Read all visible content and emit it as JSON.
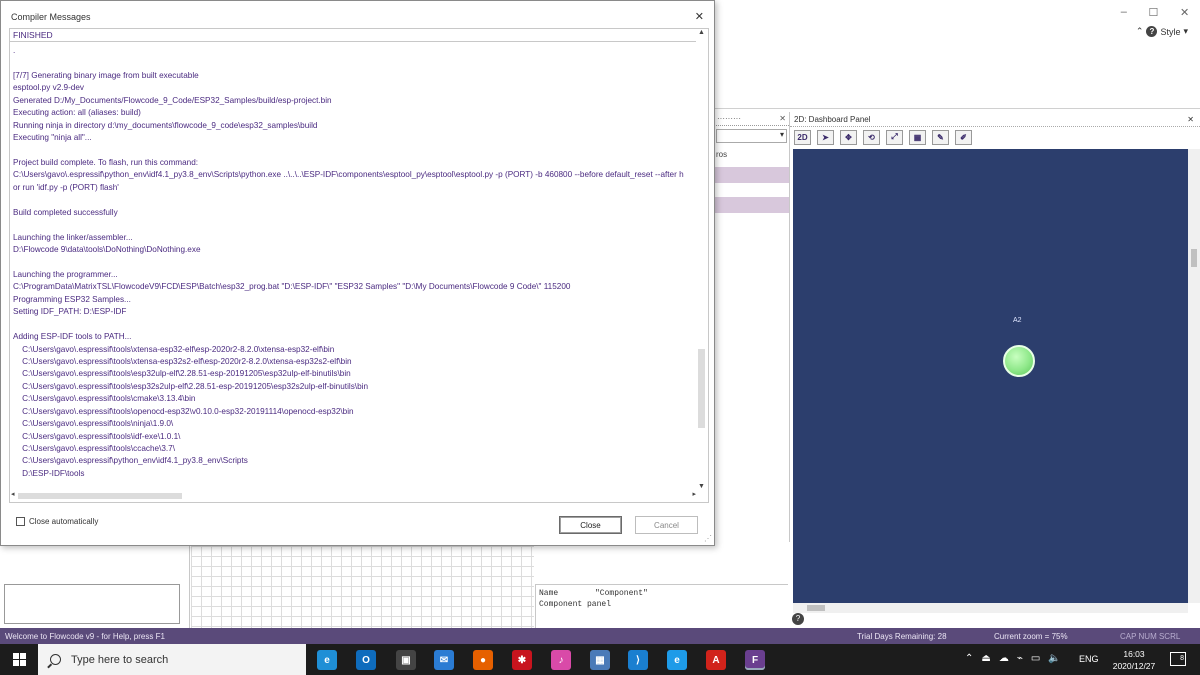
{
  "app": {
    "style_label": "Style",
    "help_label": "?",
    "window_controls": [
      "–",
      "☐",
      "✕"
    ]
  },
  "side_panel": {
    "tab_fragment": "ros"
  },
  "dashboard": {
    "title": "2D: Dashboard Panel",
    "toolbar_label": "2D",
    "component_label": "A2",
    "background_color": "#2c3e6d",
    "component_color": "#8fe88a"
  },
  "properties": {
    "rows": [
      {
        "key": "Name",
        "value": "\"Component\""
      },
      {
        "key": "Component panel",
        "value": ""
      }
    ]
  },
  "statusbar": {
    "help_text": "Welcome to Flowcode v9 - for Help, press F1",
    "trial": "Trial Days Remaining: 28",
    "zoom": "Current zoom = 75%",
    "keys": "CAP  NUM  SCRL"
  },
  "dialog": {
    "title": "Compiler Messages",
    "status": "FINISHED",
    "lines": [
      ".",
      "",
      "[7/7] Generating binary image from built executable",
      "esptool.py v2.9-dev",
      "Generated D:/My_Documents/Flowcode_9_Code/ESP32_Samples/build/esp-project.bin",
      "Executing action: all (aliases: build)",
      "Running ninja in directory d:\\my_documents\\flowcode_9_code\\esp32_samples\\build",
      "Executing \"ninja all\"...",
      "",
      "Project build complete. To flash, run this command:",
      "C:\\Users\\gavo\\.espressif\\python_env\\idf4.1_py3.8_env\\Scripts\\python.exe ..\\..\\..\\ESP-IDF\\components\\esptool_py\\esptool\\esptool.py -p (PORT) -b 460800 --before default_reset --after h",
      "or run 'idf.py -p (PORT) flash'",
      "",
      "Build completed successfully",
      "",
      "Launching the linker/assembler...",
      "D:\\Flowcode 9\\data\\tools\\DoNothing\\DoNothing.exe",
      "",
      "Launching the programmer...",
      "C:\\ProgramData\\MatrixTSL\\FlowcodeV9\\FCD\\ESP\\Batch\\esp32_prog.bat \"D:\\ESP-IDF\\\" \"ESP32 Samples\" \"D:\\My Documents\\Flowcode 9 Code\\\" 115200",
      "Programming ESP32 Samples...",
      "Setting IDF_PATH: D:\\ESP-IDF",
      "",
      "Adding ESP-IDF tools to PATH...",
      "    C:\\Users\\gavo\\.espressif\\tools\\xtensa-esp32-elf\\esp-2020r2-8.2.0\\xtensa-esp32-elf\\bin",
      "    C:\\Users\\gavo\\.espressif\\tools\\xtensa-esp32s2-elf\\esp-2020r2-8.2.0\\xtensa-esp32s2-elf\\bin",
      "    C:\\Users\\gavo\\.espressif\\tools\\esp32ulp-elf\\2.28.51-esp-20191205\\esp32ulp-elf-binutils\\bin",
      "    C:\\Users\\gavo\\.espressif\\tools\\esp32s2ulp-elf\\2.28.51-esp-20191205\\esp32s2ulp-elf-binutils\\bin",
      "    C:\\Users\\gavo\\.espressif\\tools\\cmake\\3.13.4\\bin",
      "    C:\\Users\\gavo\\.espressif\\tools\\openocd-esp32\\v0.10.0-esp32-20191114\\openocd-esp32\\bin",
      "    C:\\Users\\gavo\\.espressif\\tools\\ninja\\1.9.0\\",
      "    C:\\Users\\gavo\\.espressif\\tools\\idf-exe\\1.0.1\\",
      "    C:\\Users\\gavo\\.espressif\\tools\\ccache\\3.7\\",
      "    C:\\Users\\gavo\\.espressif\\python_env\\idf4.1_py3.8_env\\Scripts",
      "    D:\\ESP-IDF\\tools"
    ],
    "close_auto_label": "Close automatically",
    "close_button": "Close",
    "cancel_button": "Cancel",
    "close_symbol": "✕"
  },
  "taskbar": {
    "search_placeholder": "Type here to search",
    "language": "ENG",
    "time": "16:03",
    "date": "2020/12/27",
    "notification_count": "8",
    "apps": [
      {
        "name": "edge-icon",
        "color": "#1f8fd6",
        "glyph": "e"
      },
      {
        "name": "outlook-icon",
        "color": "#0f6cbd",
        "glyph": "O"
      },
      {
        "name": "store-icon",
        "color": "#444444",
        "glyph": "▣"
      },
      {
        "name": "mail-icon",
        "color": "#2b7cd3",
        "glyph": "✉"
      },
      {
        "name": "firefox-icon",
        "color": "#e66000",
        "glyph": "●"
      },
      {
        "name": "bug-app-icon",
        "color": "#c8141e",
        "glyph": "✱"
      },
      {
        "name": "itunes-icon",
        "color": "#d94aa8",
        "glyph": "♪"
      },
      {
        "name": "remote-desktop-icon",
        "color": "#4a7ab8",
        "glyph": "▦"
      },
      {
        "name": "vscode-icon",
        "color": "#1a7fd0",
        "glyph": "⟩"
      },
      {
        "name": "ie-icon",
        "color": "#1e9be8",
        "glyph": "e"
      },
      {
        "name": "pdf-icon",
        "color": "#d1231b",
        "glyph": "A"
      },
      {
        "name": "flowcode-icon",
        "color": "#6a3f8f",
        "glyph": "F"
      }
    ]
  }
}
